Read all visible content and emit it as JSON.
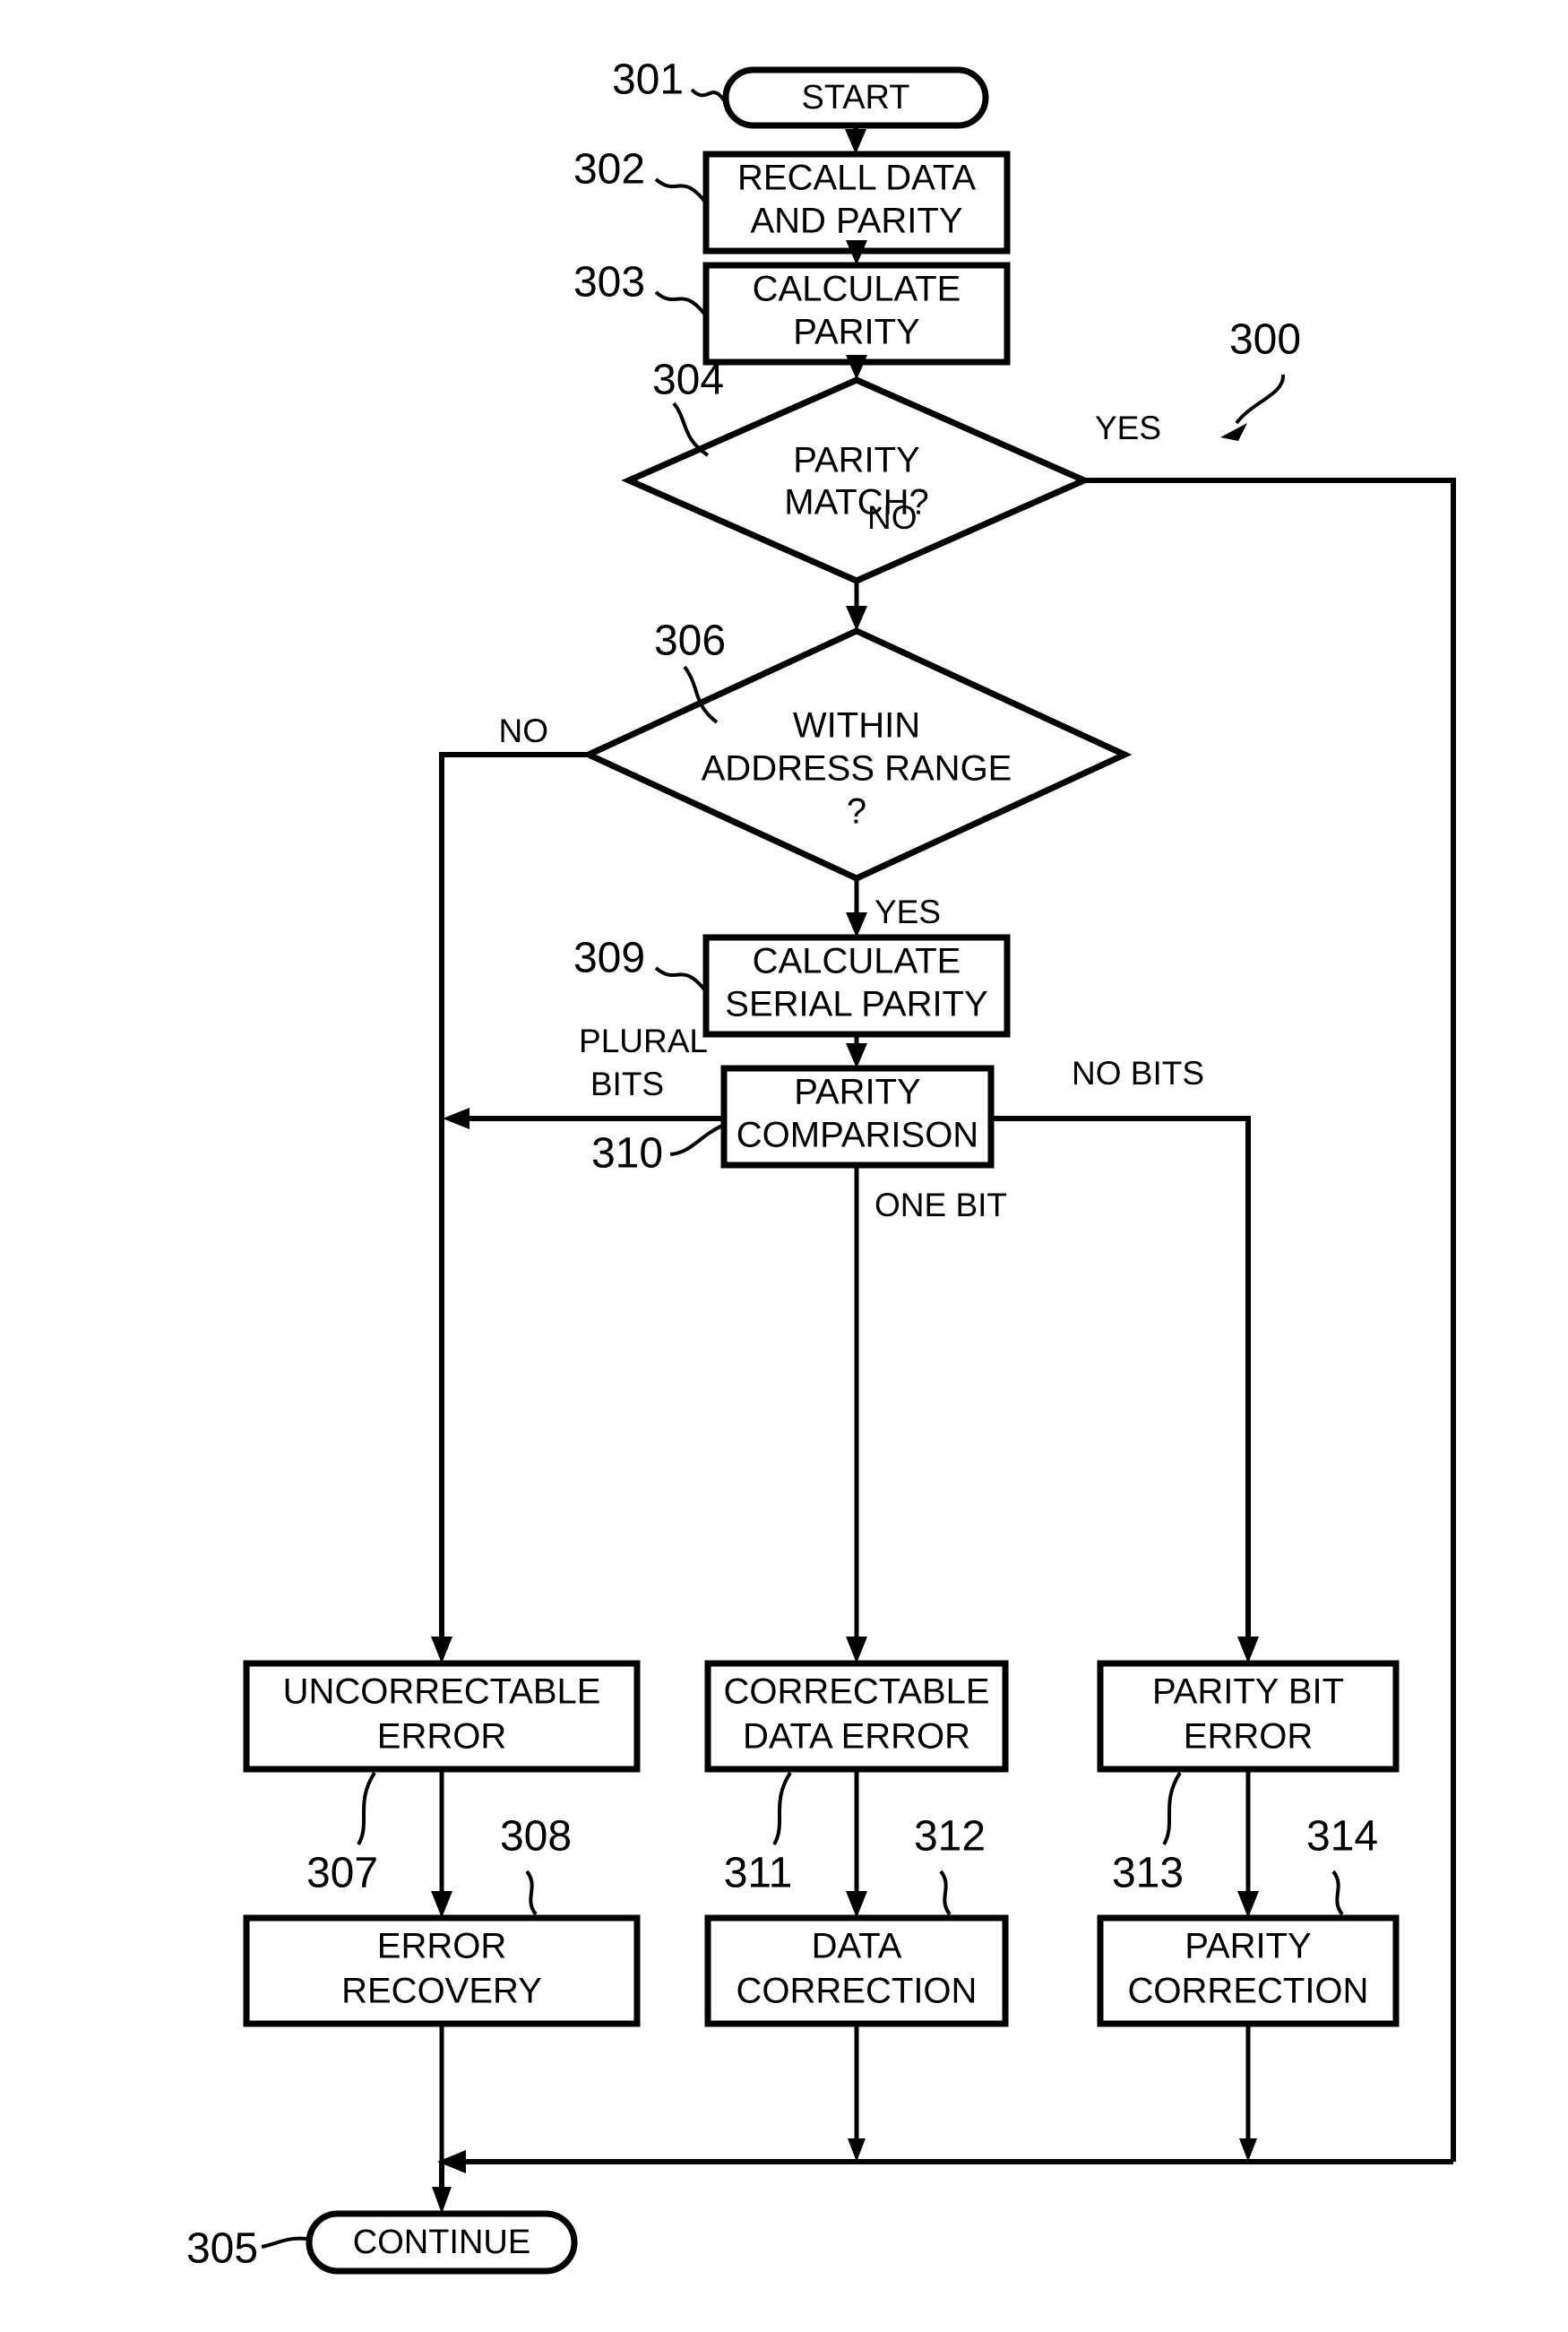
{
  "figure": {
    "id_label": "300",
    "nodes": {
      "start": {
        "ref": "301",
        "label": "START",
        "type": "terminator"
      },
      "recall": {
        "ref": "302",
        "line1": "RECALL DATA",
        "line2": "AND PARITY",
        "type": "process"
      },
      "calc_parity": {
        "ref": "303",
        "line1": "CALCULATE",
        "line2": "PARITY",
        "type": "process"
      },
      "parity_match": {
        "ref": "304",
        "line1": "PARITY",
        "line2": "MATCH?",
        "type": "decision"
      },
      "continue": {
        "ref": "305",
        "label": "CONTINUE",
        "type": "terminator"
      },
      "within_range": {
        "ref": "306",
        "line1": "WITHIN",
        "line2": "ADDRESS RANGE",
        "line3": "?",
        "type": "decision"
      },
      "uncorrectable_error": {
        "ref": "307",
        "line1": "UNCORRECTABLE",
        "line2": "ERROR",
        "type": "process"
      },
      "error_recovery": {
        "ref": "308",
        "line1": "ERROR",
        "line2": "RECOVERY",
        "type": "process"
      },
      "calc_serial_parity": {
        "ref": "309",
        "line1": "CALCULATE",
        "line2": "SERIAL PARITY",
        "type": "process"
      },
      "parity_comparison": {
        "ref": "310",
        "line1": "PARITY",
        "line2": "COMPARISON",
        "type": "process"
      },
      "correctable_data_error": {
        "ref": "311",
        "line1": "CORRECTABLE",
        "line2": "DATA ERROR",
        "type": "process"
      },
      "data_correction": {
        "ref": "312",
        "line1": "DATA",
        "line2": "CORRECTION",
        "type": "process"
      },
      "parity_bit_error": {
        "ref": "313",
        "line1": "PARITY BIT",
        "line2": "ERROR",
        "type": "process"
      },
      "parity_correction": {
        "ref": "314",
        "line1": "PARITY",
        "line2": "CORRECTION",
        "type": "process"
      }
    },
    "edge_labels": {
      "parity_match_yes": "YES",
      "parity_match_no": "NO",
      "within_range_no": "NO",
      "within_range_yes": "YES",
      "comparison_plural_1": "PLURAL",
      "comparison_plural_2": "BITS",
      "comparison_one_bit": "ONE BIT",
      "comparison_no_bits": "NO BITS"
    },
    "colors": {
      "ink": "#000000",
      "paper": "#ffffff"
    }
  }
}
